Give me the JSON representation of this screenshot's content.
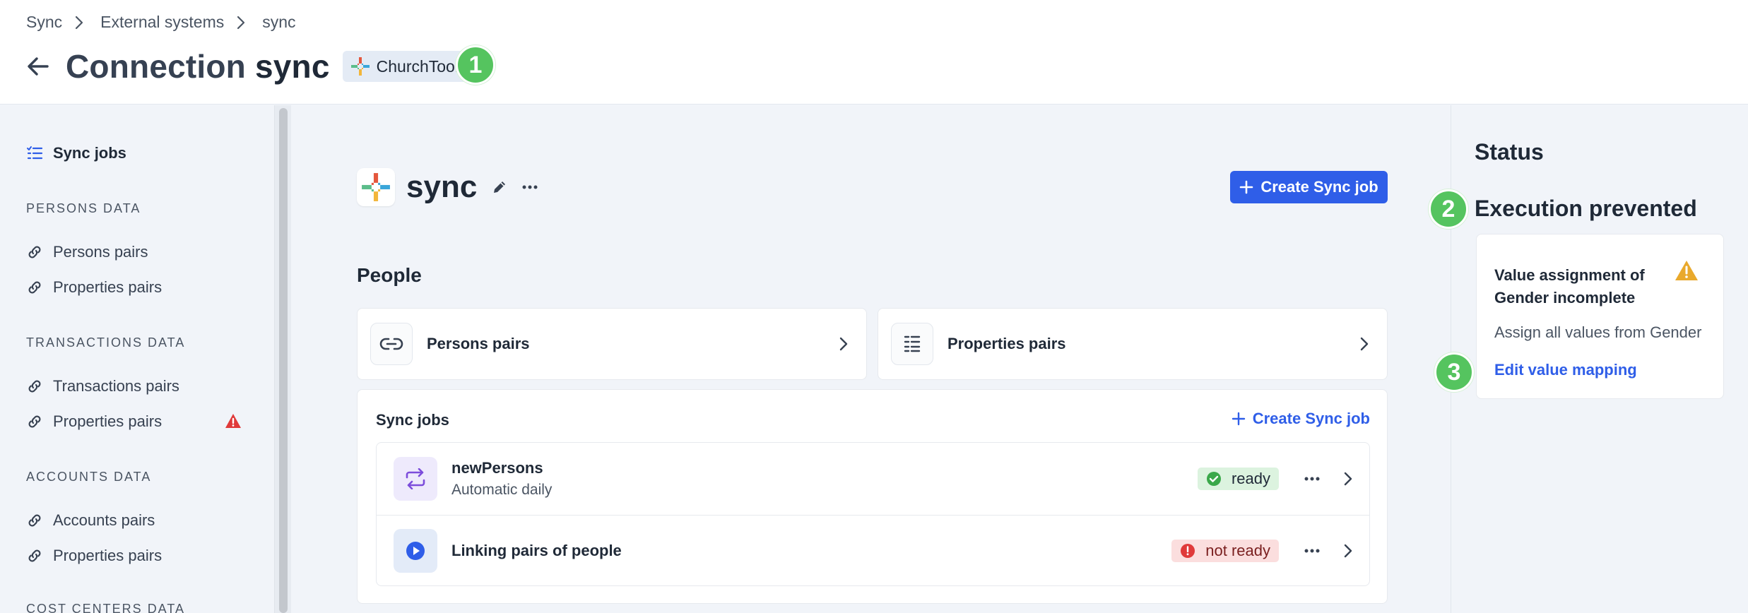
{
  "breadcrumb": [
    "Sync",
    "External systems",
    "sync"
  ],
  "header": {
    "title_prefix": "Connection",
    "title_strong": "sync",
    "system_badge": "ChurchTools"
  },
  "callouts": {
    "one": "1",
    "two": "2",
    "three": "3"
  },
  "sidebar": {
    "active_item": "Sync jobs",
    "sections": [
      {
        "heading": "PERSONS DATA",
        "items": [
          "Persons pairs",
          "Properties pairs"
        ]
      },
      {
        "heading": "TRANSACTIONS DATA",
        "items": [
          "Transactions pairs",
          "Properties pairs"
        ]
      },
      {
        "heading": "ACCOUNTS DATA",
        "items": [
          "Accounts pairs",
          "Properties pairs"
        ]
      },
      {
        "heading": "COST CENTERS DATA",
        "items": []
      }
    ]
  },
  "main": {
    "sync_name": "sync",
    "create_button": "Create Sync job",
    "section_title": "People",
    "cards": [
      "Persons pairs",
      "Properties pairs"
    ],
    "jobs": {
      "title": "Sync jobs",
      "create_link": "Create Sync job",
      "rows": [
        {
          "name": "newPersons",
          "subtitle": "Automatic daily",
          "status": "ready"
        },
        {
          "name": "Linking pairs of people",
          "subtitle": "",
          "status": "not ready"
        }
      ]
    }
  },
  "status_panel": {
    "title": "Status",
    "state": "Execution prevented",
    "card_heading": "Value assignment of Gender incomplete",
    "card_body": "Assign all values from Gender",
    "card_link": "Edit value mapping"
  },
  "colors": {
    "primary": "#2f5ee8",
    "callout_green": "#55c45f",
    "ok_bg": "#dcf3df",
    "error_bg": "#fbdede",
    "warning": "#e9a92c",
    "error": "#e03a3a"
  }
}
